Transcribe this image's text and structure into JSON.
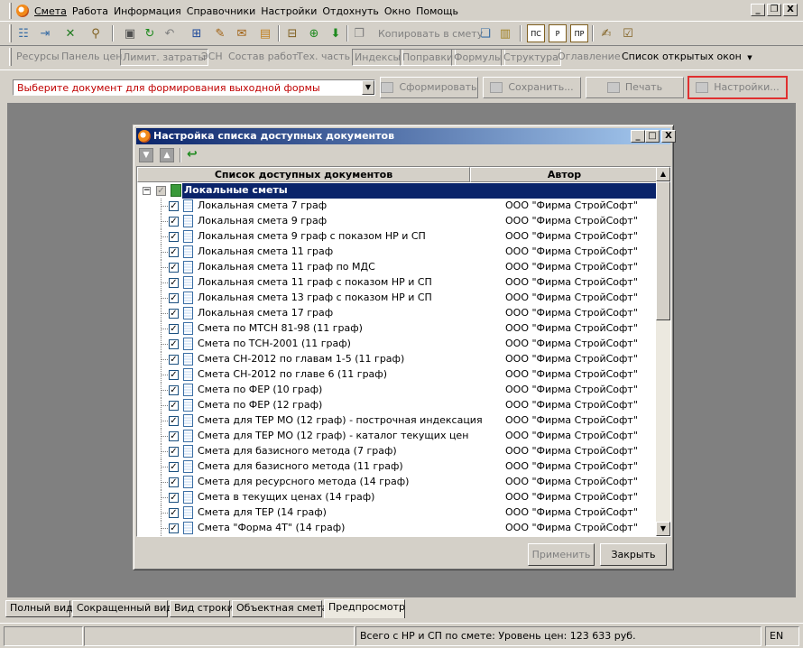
{
  "menubar": {
    "items": [
      "Смета",
      "Работа",
      "Информация",
      "Справочники",
      "Настройки",
      "Отдохнуть",
      "Окно",
      "Помощь"
    ],
    "window_buttons": [
      "_",
      "❐",
      "X"
    ]
  },
  "toolbar1": {
    "copy_label": "Копировать в смету",
    "icon_labels": [
      "ПС",
      "Р",
      "ПР"
    ]
  },
  "tabs": {
    "items": [
      "Ресурсы",
      "Панель цен",
      "Лимит. затраты",
      "ЭСН",
      "Состав работ",
      "Тех. часть",
      "Индексы",
      "Поправки",
      "Формулы",
      "Структура",
      "Оглавление",
      "Список открытых окон"
    ],
    "dropdown_arrow": "▼"
  },
  "actionbar": {
    "doc_select_placeholder": "Выберите документ для формирования выходной формы",
    "form_label": "Сформировать",
    "save_label": "Сохранить...",
    "print_label": "Печать",
    "settings_label": "Настройки..."
  },
  "dialog": {
    "title": "Настройка списка доступных документов",
    "window_buttons": [
      "_",
      "□",
      "X"
    ],
    "col_docs": "Список доступных документов",
    "col_author": "Автор",
    "group_label": "Локальные сметы",
    "rows": [
      {
        "name": "Локальная смета 7 граф",
        "author": "ООО \"Фирма СтройСофт\""
      },
      {
        "name": "Локальная смета 9 граф",
        "author": "ООО \"Фирма СтройСофт\""
      },
      {
        "name": "Локальная смета 9 граф с показом НР и СП",
        "author": "ООО \"Фирма СтройСофт\""
      },
      {
        "name": "Локальная смета 11 граф",
        "author": "ООО \"Фирма СтройСофт\""
      },
      {
        "name": "Локальная смета 11 граф по МДС",
        "author": "ООО \"Фирма СтройСофт\""
      },
      {
        "name": "Локальная смета 11 граф с показом НР и СП",
        "author": "ООО \"Фирма СтройСофт\""
      },
      {
        "name": "Локальная смета 13 граф с показом НР и СП",
        "author": "ООО \"Фирма СтройСофт\""
      },
      {
        "name": "Локальная смета 17 граф",
        "author": "ООО \"Фирма СтройСофт\""
      },
      {
        "name": "Смета по МТСН 81-98 (11 граф)",
        "author": "ООО \"Фирма СтройСофт\""
      },
      {
        "name": "Смета по ТСН-2001 (11 граф)",
        "author": "ООО \"Фирма СтройСофт\""
      },
      {
        "name": "Смета СН-2012 по главам 1-5 (11 граф)",
        "author": "ООО \"Фирма СтройСофт\""
      },
      {
        "name": "Смета СН-2012 по главе 6 (11 граф)",
        "author": "ООО \"Фирма СтройСофт\""
      },
      {
        "name": "Смета по ФЕР  (10 граф)",
        "author": "ООО \"Фирма СтройСофт\""
      },
      {
        "name": "Смета по ФЕР (12 граф)",
        "author": "ООО \"Фирма СтройСофт\""
      },
      {
        "name": "Смета для ТЕР МО  (12 граф) - построчная индексация",
        "author": "ООО \"Фирма СтройСофт\""
      },
      {
        "name": "Смета для ТЕР МО  (12 граф) - каталог текущих цен",
        "author": "ООО \"Фирма СтройСофт\""
      },
      {
        "name": "Смета для базисного метода  (7 граф)",
        "author": "ООО \"Фирма СтройСофт\""
      },
      {
        "name": "Смета для базисного метода  (11 граф)",
        "author": "ООО \"Фирма СтройСофт\""
      },
      {
        "name": "Смета для ресурсного метода  (14 граф)",
        "author": "ООО \"Фирма СтройСофт\""
      },
      {
        "name": "Смета в текущих ценах  (14 граф)",
        "author": "ООО \"Фирма СтройСофт\""
      },
      {
        "name": "Смета для ТЕР  (14 граф)",
        "author": "ООО \"Фирма СтройСофт\""
      },
      {
        "name": "Смета \"Форма 4Т\"  (14 граф)",
        "author": "ООО \"Фирма СтройСофт\""
      }
    ],
    "apply_label": "Применить",
    "close_label": "Закрыть"
  },
  "bottom_tabs": [
    "Полный вид",
    "Сокращенный вид",
    "Вид строки",
    "Объектная смета",
    "Предпросмотр"
  ],
  "statusbar": {
    "total": "Всего с НР и СП по смете: Уровень цен: 123 633 руб.",
    "lang": "EN"
  }
}
